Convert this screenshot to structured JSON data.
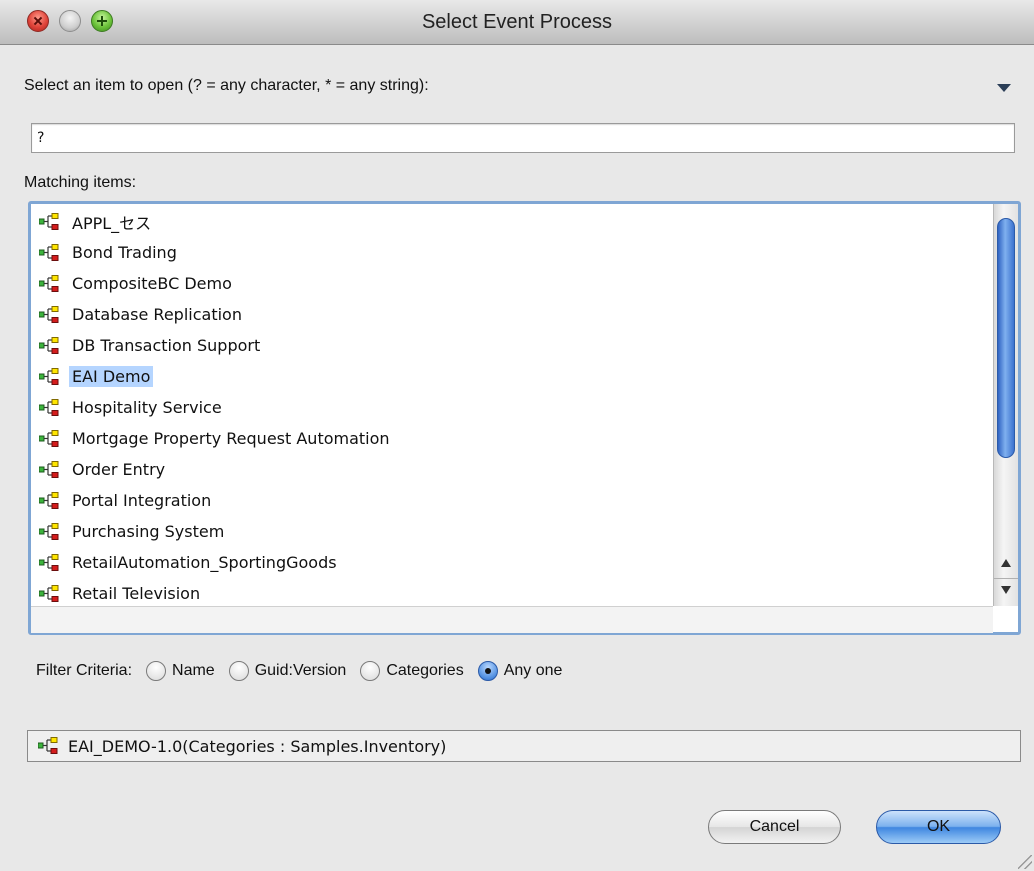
{
  "window": {
    "title": "Select Event Process"
  },
  "prompt": {
    "label": "Select an item to open (? = any character, * = any string):",
    "input_value": "?"
  },
  "matching": {
    "label": "Matching items:",
    "items": [
      {
        "label": "APPL_セス",
        "icon": "process-icon"
      },
      {
        "label": "Bond Trading",
        "icon": "process-icon"
      },
      {
        "label": "CompositeBC Demo",
        "icon": "process-icon"
      },
      {
        "label": "Database Replication",
        "icon": "process-icon"
      },
      {
        "label": "DB Transaction Support",
        "icon": "process-icon"
      },
      {
        "label": "EAI Demo",
        "icon": "process-icon",
        "selected": true
      },
      {
        "label": "Hospitality Service",
        "icon": "process-icon"
      },
      {
        "label": "Mortgage Property Request Automation",
        "icon": "process-icon"
      },
      {
        "label": "Order Entry",
        "icon": "process-icon"
      },
      {
        "label": "Portal Integration",
        "icon": "process-icon"
      },
      {
        "label": "Purchasing System",
        "icon": "process-icon"
      },
      {
        "label": "RetailAutomation_SportingGoods",
        "icon": "process-icon"
      },
      {
        "label": "Retail Television",
        "icon": "process-icon"
      }
    ]
  },
  "filter": {
    "label": "Filter Criteria:",
    "options": [
      {
        "label": "Name",
        "checked": false
      },
      {
        "label": "Guid:Version",
        "checked": false
      },
      {
        "label": "Categories",
        "checked": false
      },
      {
        "label": "Any one",
        "checked": true
      }
    ]
  },
  "status": {
    "text": "EAI_DEMO-1.0(Categories : Samples.Inventory)"
  },
  "buttons": {
    "cancel": "Cancel",
    "ok": "OK"
  },
  "colors": {
    "selection": "#b5d5ff",
    "focus_ring": "#7fa6d4",
    "icon_green": "#3cb43c",
    "icon_red": "#d41c1c",
    "icon_yellow": "#ffe600"
  }
}
